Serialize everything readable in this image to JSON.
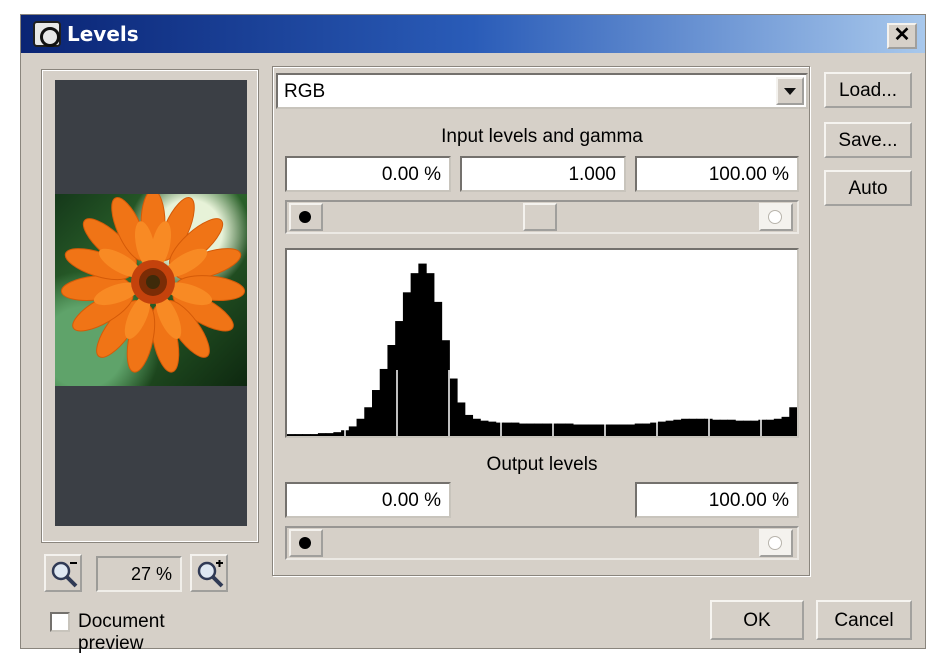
{
  "window": {
    "title": "Levels",
    "close_label": "✕"
  },
  "combo": {
    "value": "RGB"
  },
  "input": {
    "label": "Input levels and gamma",
    "black": "0.00 %",
    "gamma": "1.000",
    "white": "100.00 %"
  },
  "output": {
    "label": "Output levels",
    "black": "0.00 %",
    "white": "100.00 %"
  },
  "buttons": {
    "load": "Load...",
    "save": "Save...",
    "auto": "Auto",
    "ok": "OK",
    "cancel": "Cancel"
  },
  "preview": {
    "zoom": "27 %",
    "document_preview_label": "Document preview",
    "document_preview_checked": false
  },
  "icons": [
    "app-icon",
    "close-icon",
    "zoom-out-icon",
    "zoom-in-icon",
    "dropdown-arrow-icon"
  ],
  "histogram": {
    "channel": "RGB",
    "bins": [
      2,
      2,
      2,
      2,
      3,
      3,
      4,
      6,
      10,
      18,
      30,
      48,
      70,
      95,
      120,
      150,
      170,
      180,
      170,
      140,
      100,
      60,
      35,
      22,
      18,
      16,
      15,
      14,
      14,
      14,
      13,
      13,
      13,
      13,
      13,
      13,
      13,
      12,
      12,
      12,
      12,
      12,
      12,
      12,
      12,
      13,
      13,
      14,
      15,
      16,
      17,
      18,
      18,
      18,
      18,
      17,
      17,
      17,
      16,
      16,
      16,
      17,
      17,
      18,
      20,
      30
    ]
  }
}
